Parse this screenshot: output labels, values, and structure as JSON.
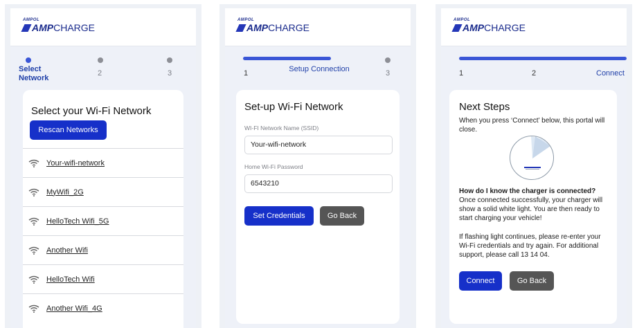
{
  "brand": {
    "top": "AMPOL",
    "amp": "AMP",
    "charge": "CHARGE"
  },
  "screen1": {
    "steps": [
      "Select Network",
      "2",
      "3"
    ],
    "title": "Select your Wi-Fi Network",
    "rescan_label": "Rescan Networks",
    "networks": [
      "Your-wifi-network",
      "MyWifi_2G",
      "HelloTech Wifi_5G",
      "Another Wifi",
      "HelloTech Wifi",
      "Another Wifi_4G"
    ]
  },
  "screen2": {
    "steps": [
      "1",
      "Setup Connection",
      "3"
    ],
    "title": "Set-up Wi-Fi Network",
    "ssid_label": "WI-FI Network Name (SSID)",
    "ssid_value": "Your-wifi-network",
    "password_label": "Home Wi-Fi Password",
    "password_value": "6543210",
    "set_label": "Set Credentials",
    "back_label": "Go Back"
  },
  "screen3": {
    "steps": [
      "1",
      "2",
      "Connect"
    ],
    "title": "Next Steps",
    "intro": "When you press ‘Connect’ below, this portal will close.",
    "question": "How do I know the charger is connected?",
    "answer": "Once connected successfully, your charger will show a solid white light. You are then ready to start charging your vehicle!",
    "flashing": "If flashing light continues, please re-enter your Wi-Fi credentials and try again. For additional support, please call 13 14 04.",
    "connect_label": "Connect",
    "back_label": "Go Back"
  },
  "colors": {
    "accent": "#1630c9",
    "progress": "#3a56d6",
    "gray_button": "#555555"
  }
}
